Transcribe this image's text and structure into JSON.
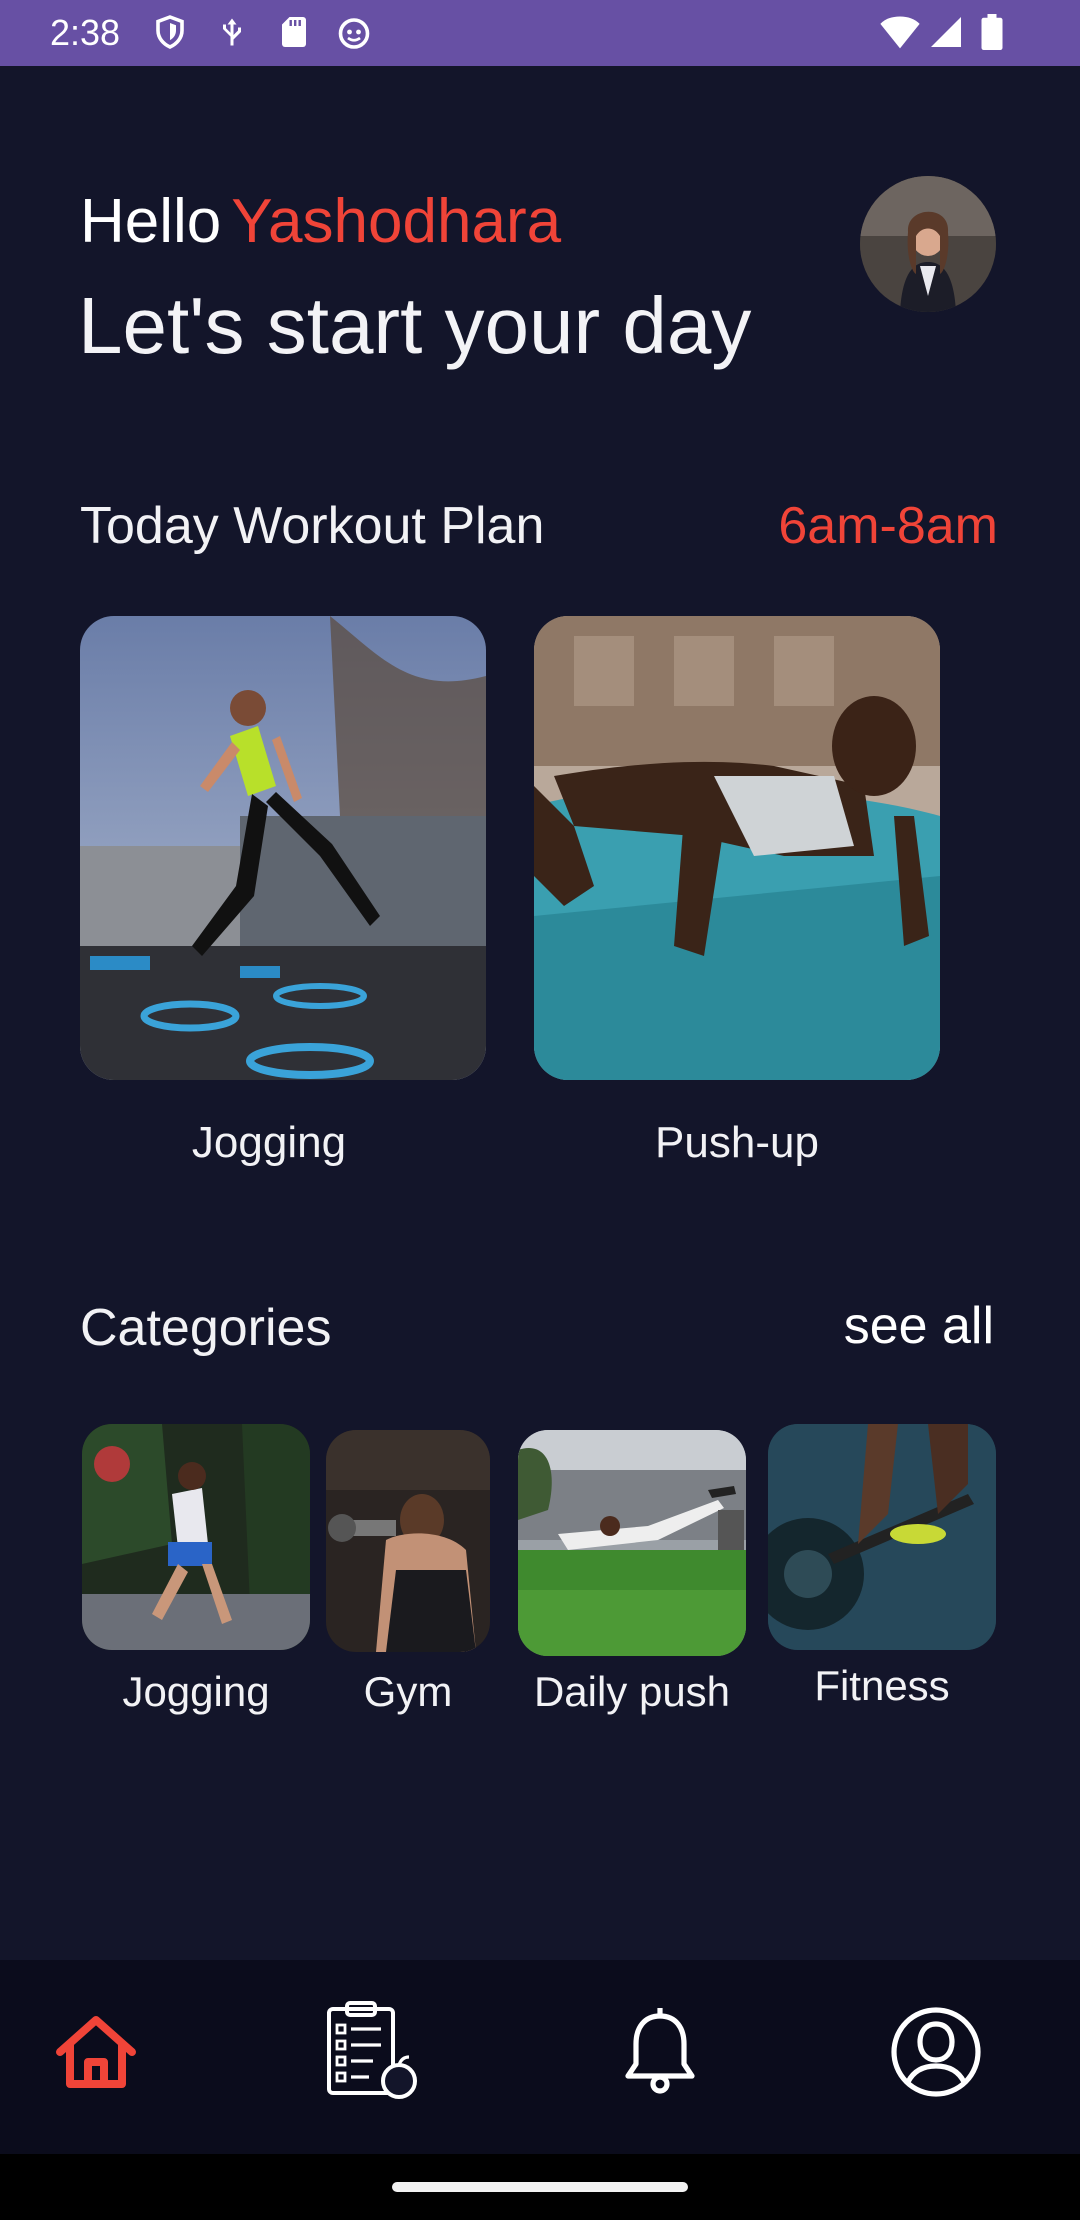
{
  "status_bar": {
    "time": "2:38",
    "icons_left": [
      "shield-icon",
      "usb-icon",
      "sd-card-icon",
      "android-bug-icon"
    ],
    "icons_right": [
      "wifi-icon",
      "signal-icon",
      "battery-icon"
    ],
    "color": "#6750a4"
  },
  "header": {
    "greeting": "Hello",
    "user_name": "Yashodhara",
    "headline": "Let's start your day",
    "accent_color": "#f04438"
  },
  "workout_plan": {
    "title": "Today Workout Plan",
    "time_range": "6am-8am",
    "cards": [
      {
        "label": "Jogging",
        "image": "woman-running-photo"
      },
      {
        "label": "Push-up",
        "image": "man-pushup-photo"
      }
    ]
  },
  "categories": {
    "title": "Categories",
    "see_all": "see all",
    "items": [
      {
        "label": "Jogging",
        "image": "jogging-photo"
      },
      {
        "label": "Gym",
        "image": "gym-photo"
      },
      {
        "label": "Daily push",
        "image": "daily-push-photo"
      },
      {
        "label": "Fitness",
        "image": "fitness-photo"
      }
    ]
  },
  "bottom_nav": {
    "items": [
      {
        "name": "home",
        "icon": "home-icon",
        "active": true
      },
      {
        "name": "diet-plan",
        "icon": "clipboard-apple-icon",
        "active": false
      },
      {
        "name": "notifications",
        "icon": "bell-icon",
        "active": false
      },
      {
        "name": "profile",
        "icon": "profile-icon",
        "active": false
      }
    ]
  }
}
